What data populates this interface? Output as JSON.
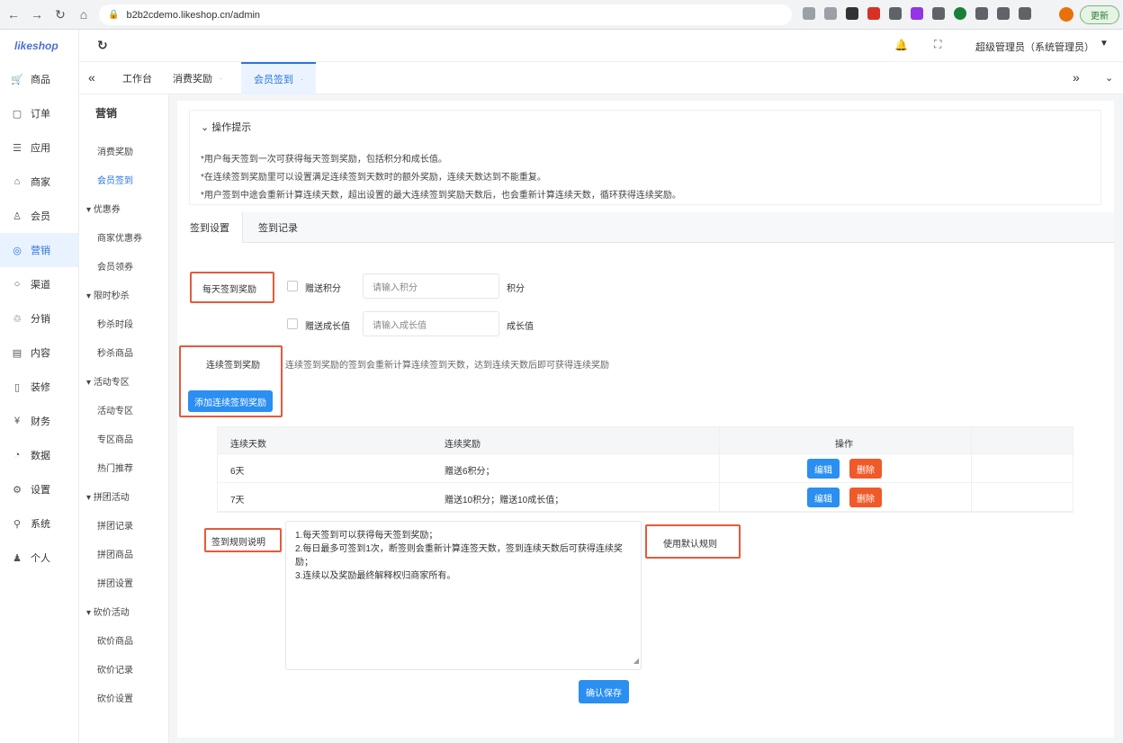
{
  "browser": {
    "url": "b2b2cdemo.likeshop.cn/admin",
    "update_label": "更新"
  },
  "brand": "likeshop",
  "sidebar": {
    "items": [
      {
        "label": "商品",
        "icon": "cart-icon"
      },
      {
        "label": "订单",
        "icon": "order-icon"
      },
      {
        "label": "应用",
        "icon": "app-icon"
      },
      {
        "label": "商家",
        "icon": "store-icon"
      },
      {
        "label": "会员",
        "icon": "user-icon"
      },
      {
        "label": "营销",
        "icon": "marketing-icon"
      },
      {
        "label": "渠道",
        "icon": "channel-icon"
      },
      {
        "label": "分销",
        "icon": "distribution-icon"
      },
      {
        "label": "内容",
        "icon": "content-icon"
      },
      {
        "label": "装修",
        "icon": "decorate-icon"
      },
      {
        "label": "财务",
        "icon": "finance-icon"
      },
      {
        "label": "数据",
        "icon": "data-icon"
      },
      {
        "label": "设置",
        "icon": "settings-icon"
      },
      {
        "label": "系统",
        "icon": "system-icon"
      },
      {
        "label": "个人",
        "icon": "person-icon"
      }
    ],
    "active_index": 5
  },
  "topbar": {
    "user": "超级管理员（系统管理员）"
  },
  "tabs": [
    {
      "label": "工作台"
    },
    {
      "label": "消费奖励"
    },
    {
      "label": "会员签到"
    }
  ],
  "submenu": {
    "title": "营销",
    "entries": [
      {
        "label": "消费奖励",
        "type": "item"
      },
      {
        "label": "会员签到",
        "type": "item",
        "active": true
      },
      {
        "label": "优惠券",
        "type": "group"
      },
      {
        "label": "商家优惠券",
        "type": "item"
      },
      {
        "label": "会员领券",
        "type": "item"
      },
      {
        "label": "限时秒杀",
        "type": "group"
      },
      {
        "label": "秒杀时段",
        "type": "item"
      },
      {
        "label": "秒杀商品",
        "type": "item"
      },
      {
        "label": "活动专区",
        "type": "group"
      },
      {
        "label": "活动专区",
        "type": "item"
      },
      {
        "label": "专区商品",
        "type": "item"
      },
      {
        "label": "热门推荐",
        "type": "item"
      },
      {
        "label": "拼团活动",
        "type": "group"
      },
      {
        "label": "拼团记录",
        "type": "item"
      },
      {
        "label": "拼团商品",
        "type": "item"
      },
      {
        "label": "拼团设置",
        "type": "item"
      },
      {
        "label": "砍价活动",
        "type": "group"
      },
      {
        "label": "砍价商品",
        "type": "item"
      },
      {
        "label": "砍价记录",
        "type": "item"
      },
      {
        "label": "砍价设置",
        "type": "item"
      }
    ]
  },
  "tips": {
    "title": "操作提示",
    "lines": [
      "*用户每天签到一次可获得每天签到奖励，包括积分和成长值。",
      "*在连续签到奖励里可以设置满足连续签到天数时的额外奖励，连续天数达到不能重复。",
      "*用户签到中途会重新计算连续天数，超出设置的最大连续签到奖励天数后，也会重新计算连续天数，循环获得连续奖励。"
    ]
  },
  "inner_tabs": [
    {
      "label": "签到设置"
    },
    {
      "label": "签到记录"
    }
  ],
  "form": {
    "daily_label": "每天签到奖励",
    "points_checkbox": "赠送积分",
    "points_placeholder": "请输入积分",
    "points_unit": "积分",
    "growth_checkbox": "赠送成长值",
    "growth_placeholder": "请输入成长值",
    "growth_unit": "成长值",
    "continuous_label": "连续签到奖励",
    "continuous_desc": "连续签到奖励的签到会重新计算连续签到天数，达到连续天数后即可获得连续奖励",
    "add_button": "添加连续签到奖励",
    "rules_label": "签到规则说明",
    "rules_text": "1.每天签到可以获得每天签到奖励；\n2.每日最多可签到1次，断签则会重新计算连签天数，签到连续天数后可获得连续奖励；\n3.连续以及奖励最终解释权归商家所有。",
    "default_rules_button": "使用默认规则",
    "submit_button": "确认保存"
  },
  "table": {
    "headers": [
      "连续天数",
      "连续奖励",
      "操作"
    ],
    "rows": [
      {
        "days": "6天",
        "reward": "赠送6积分；"
      },
      {
        "days": "7天",
        "reward": "赠送10积分；赠送10成长值；"
      }
    ],
    "edit_label": "编辑",
    "delete_label": "删除"
  }
}
